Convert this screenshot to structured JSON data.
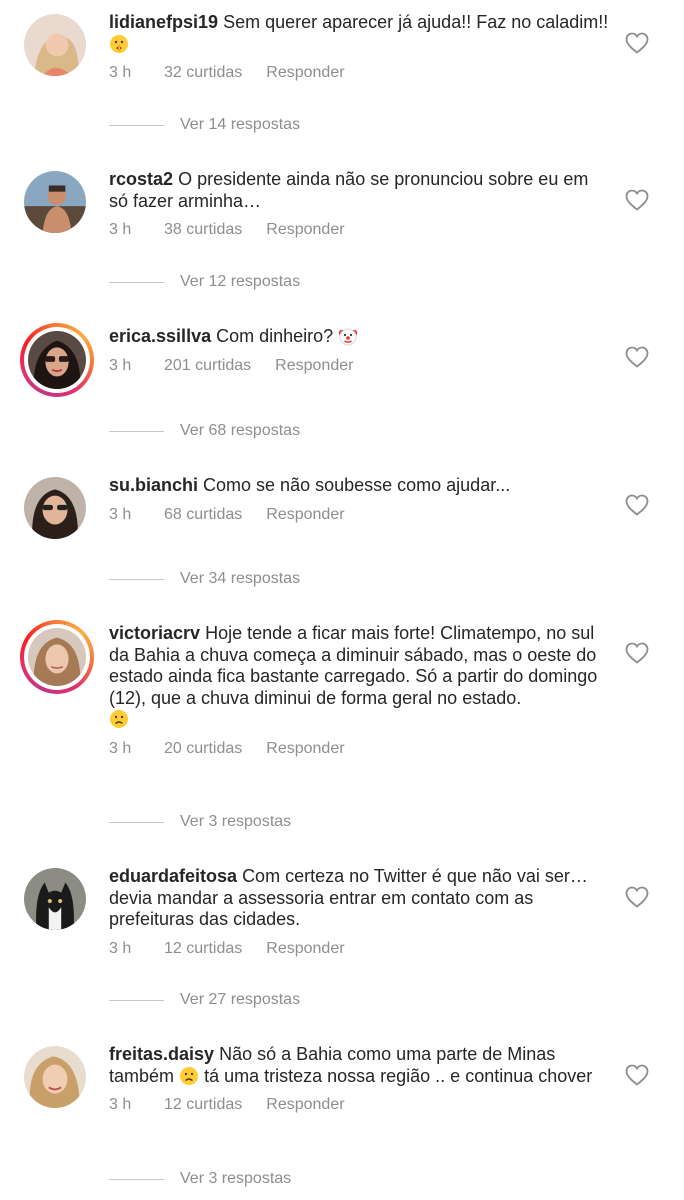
{
  "labels": {
    "reply": "Responder"
  },
  "comments": [
    {
      "username": "lidianefpsi19",
      "text": "Sem querer aparecer já ajuda!! Faz no caladim!!",
      "emoji": "shushing-face",
      "time": "3 h",
      "likes": "32 curtidas",
      "replies": "Ver 14 respostas",
      "story_ring": false
    },
    {
      "username": "rcosta2",
      "text": "O presidente ainda não se pronunciou sobre eu em só fazer arminha…",
      "time": "3 h",
      "likes": "38 curtidas",
      "replies": "Ver 12 respostas",
      "story_ring": false
    },
    {
      "username": "erica.ssillva",
      "text": "Com dinheiro?",
      "emoji": "clown-face",
      "time": "3 h",
      "likes": "201 curtidas",
      "replies": "Ver 68 respostas",
      "story_ring": true
    },
    {
      "username": "su.bianchi",
      "text": "Como se não soubesse como ajudar...",
      "time": "3 h",
      "likes": "68 curtidas",
      "replies": "Ver 34 respostas",
      "story_ring": false
    },
    {
      "username": "victoriacrv",
      "text": "Hoje tende a ficar mais forte! Climatempo, no sul da Bahia a chuva começa a diminuir sábado, mas o oeste do estado ainda fica bastante carregado. Só a partir do domingo (12), que a chuva diminui de forma geral no estado.",
      "emoji": "sad-face",
      "time": "3 h",
      "likes": "20 curtidas",
      "replies": "Ver 3 respostas",
      "story_ring": true
    },
    {
      "username": "eduardafeitosa",
      "text": "Com certeza no Twitter é que não vai ser… devia mandar a assessoria entrar em contato com as prefeituras das cidades.",
      "time": "3 h",
      "likes": "12 curtidas",
      "replies": "Ver 27 respostas",
      "story_ring": false
    },
    {
      "username": "freitas.daisy",
      "text_before": "Não só a Bahia como uma parte de Minas também",
      "emoji": "sad-face",
      "text_after": "tá uma tristeza nossa região .. e continua chover",
      "time": "3 h",
      "likes": "12 curtidas",
      "replies": "Ver 3 respostas",
      "story_ring": false
    }
  ]
}
